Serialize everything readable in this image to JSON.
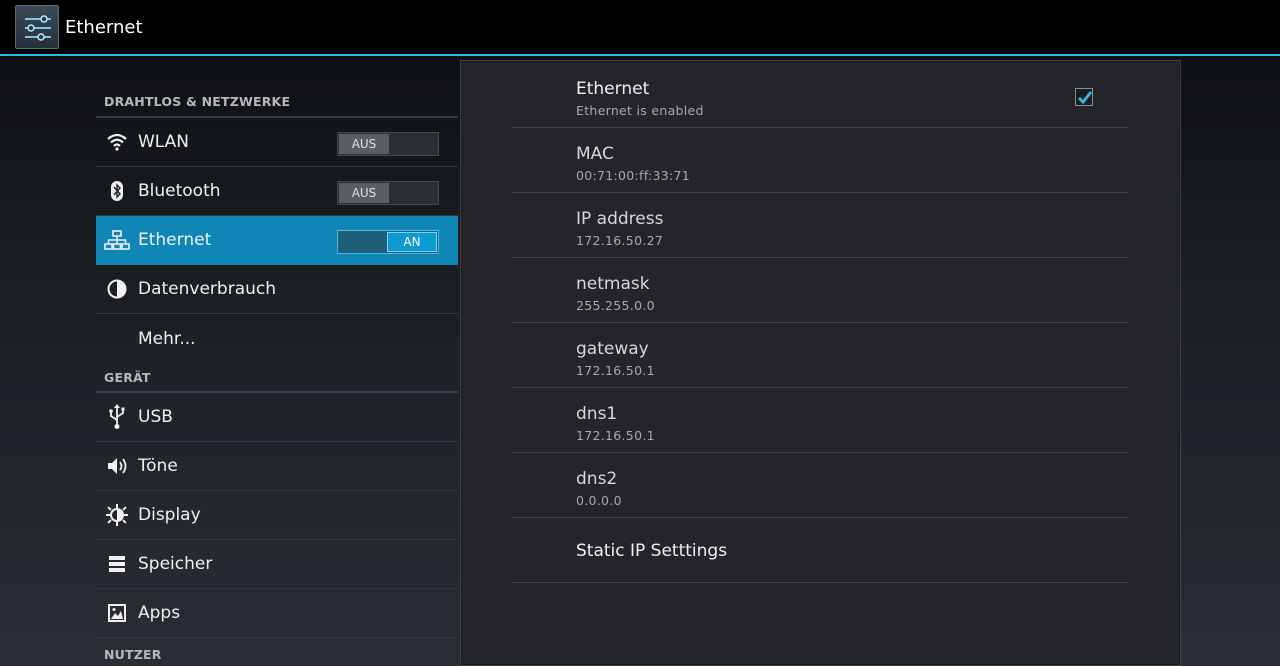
{
  "actionbar": {
    "title": "Ethernet",
    "icon": "settings-sliders-icon"
  },
  "sidebar": {
    "categories": {
      "wireless": "DRAHTLOS & NETZWERKE",
      "device": "GERÄT",
      "user": "NUTZER"
    },
    "items": [
      {
        "label": "WLAN",
        "icon": "wifi-icon",
        "toggle": "AUS"
      },
      {
        "label": "Bluetooth",
        "icon": "bluetooth-icon",
        "toggle": "AUS"
      },
      {
        "label": "Ethernet",
        "icon": "ethernet-icon",
        "toggle": "AN"
      },
      {
        "label": "Datenverbrauch",
        "icon": "data-usage-icon"
      },
      {
        "label": "Mehr...",
        "icon": ""
      },
      {
        "label": "USB",
        "icon": "usb-icon"
      },
      {
        "label": "Töne",
        "icon": "sound-icon"
      },
      {
        "label": "Display",
        "icon": "display-icon"
      },
      {
        "label": "Speicher",
        "icon": "storage-icon"
      },
      {
        "label": "Apps",
        "icon": "apps-icon"
      }
    ]
  },
  "panel": {
    "ethernet": {
      "title": "Ethernet",
      "summary": "Ethernet is enabled",
      "checked": true
    },
    "mac": {
      "title": "MAC",
      "value": "00:71:00:ff:33:71"
    },
    "ip": {
      "title": "IP address",
      "value": "172.16.50.27"
    },
    "netmask": {
      "title": "netmask",
      "value": "255.255.0.0"
    },
    "gateway": {
      "title": "gateway",
      "value": "172.16.50.1"
    },
    "dns1": {
      "title": "dns1",
      "value": "172.16.50.1"
    },
    "dns2": {
      "title": "dns2",
      "value": "0.0.0.0"
    },
    "static": {
      "title": "Static IP Setttings"
    }
  },
  "colors": {
    "accent": "#33b5e5",
    "selected": "#0f86b5"
  }
}
